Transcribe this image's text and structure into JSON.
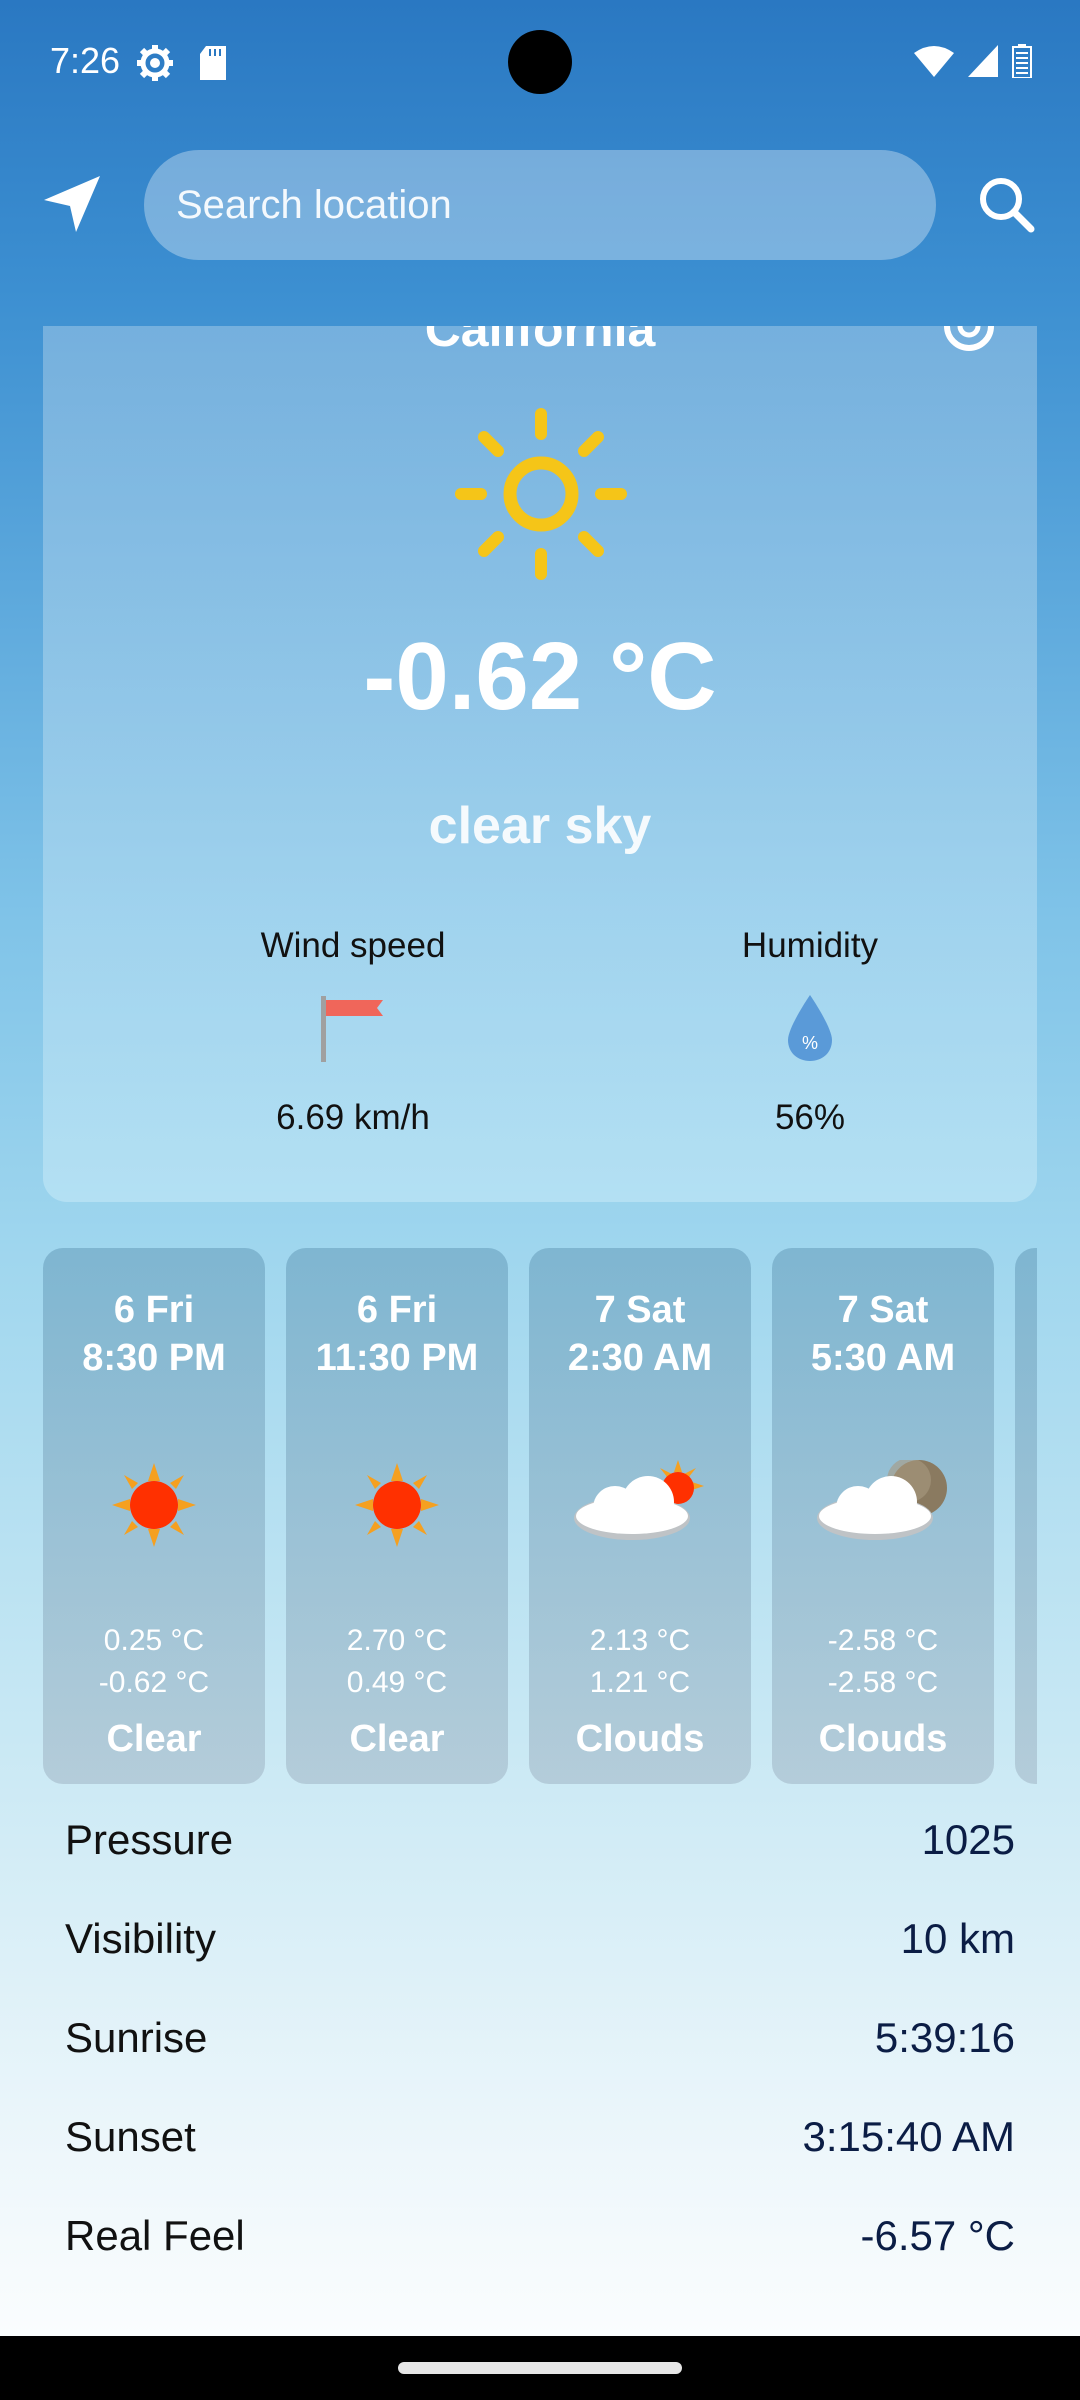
{
  "status_bar": {
    "time": "7:26"
  },
  "search": {
    "placeholder": "Search location"
  },
  "current": {
    "city": "California",
    "temperature": "-0.62 °C",
    "condition": "clear sky",
    "wind_label": "Wind speed",
    "wind_value": "6.69 km/h",
    "humidity_label": "Humidity",
    "humidity_value": "56%",
    "humidity_icon_text": "%"
  },
  "forecast": [
    {
      "day": "6 Fri",
      "time": "8:30 PM",
      "temp_max": "0.25 °C",
      "temp_min": "-0.62 °C",
      "condition": "Clear",
      "icon": "sun-icon"
    },
    {
      "day": "6 Fri",
      "time": "11:30 PM",
      "temp_max": "2.70 °C",
      "temp_min": "0.49 °C",
      "condition": "Clear",
      "icon": "sun-icon"
    },
    {
      "day": "7 Sat",
      "time": "2:30 AM",
      "temp_max": "2.13 °C",
      "temp_min": "1.21 °C",
      "condition": "Clouds",
      "icon": "cloud-sun-icon"
    },
    {
      "day": "7 Sat",
      "time": "5:30 AM",
      "temp_max": "-2.58 °C",
      "temp_min": "-2.58 °C",
      "condition": "Clouds",
      "icon": "cloud-moon-icon"
    }
  ],
  "details": [
    {
      "label": "Pressure",
      "value": "1025"
    },
    {
      "label": "Visibility",
      "value": "10 km"
    },
    {
      "label": "Sunrise",
      "value": "5:39:16"
    },
    {
      "label": "Sunset",
      "value": "3:15:40 AM"
    },
    {
      "label": "Real Feel",
      "value": "-6.57 °C"
    }
  ],
  "colors": {
    "sun_yellow": "#f5c518",
    "sun_red": "#ff3000",
    "wind_flag": "#f0665a",
    "humidity_drop": "#5a9ad8"
  }
}
